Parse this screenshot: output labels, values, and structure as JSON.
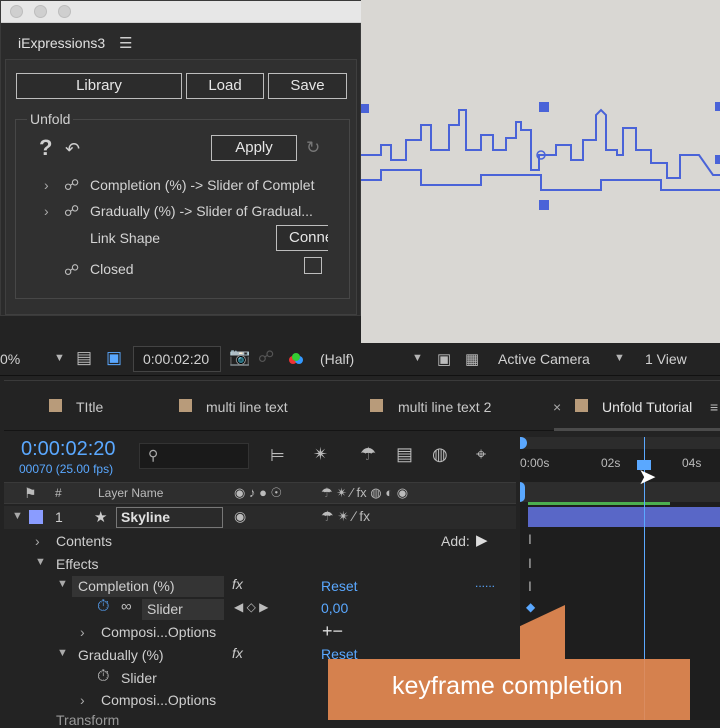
{
  "panel": {
    "title": "iExpressions3",
    "menu_icon": "hamburger-icon",
    "buttons": {
      "library": "Library",
      "load": "Load",
      "save": "Save"
    },
    "group_label": "Unfold",
    "help_icon": "?",
    "apply": "Apply",
    "links": [
      {
        "text": "Completion (%) -> Slider of Complet"
      },
      {
        "text": "Gradually (%) -> Slider of Gradual..."
      }
    ],
    "link_shape_label": "Link Shape",
    "connect_button": "Conne",
    "closed_label": "Closed"
  },
  "viewer": {
    "zoom": "0%",
    "timecode": "0:00:02:20",
    "resolution": "(Half)",
    "camera": "Active Camera",
    "views": "1 View"
  },
  "timeline": {
    "tabs": [
      {
        "label": "TItle",
        "color": "#b89b7a"
      },
      {
        "label": "multi line text",
        "color": "#b89b7a"
      },
      {
        "label": "multi line text 2",
        "color": "#b89b7a"
      },
      {
        "label": "Unfold Tutorial",
        "color": "#b89b7a",
        "active": true
      }
    ],
    "close_symbol": "×",
    "timecode": "0:00:02:20",
    "frame_info": "00070 (25.00 fps)",
    "ruler": [
      "0:00s",
      "02s",
      "04s"
    ],
    "columns": {
      "num": "#",
      "layer_name": "Layer Name"
    },
    "layer": {
      "num": "1",
      "name": "Skyline"
    },
    "contents": "Contents",
    "add_label": "Add:",
    "effects": "Effects",
    "completion": "Completion (%)",
    "reset": "Reset",
    "dots": "......",
    "slider": "Slider",
    "slider_value": "0,00",
    "compositing": "Composi...Options",
    "plusminus": "+−",
    "gradually": "Gradually (%)",
    "slider2": "Slider",
    "compositing2": "Composi...Options",
    "transform": "Transform"
  },
  "overlay": {
    "text": "keyframe completion",
    "color": "#e58a52"
  },
  "accent": "#5aa8ff"
}
